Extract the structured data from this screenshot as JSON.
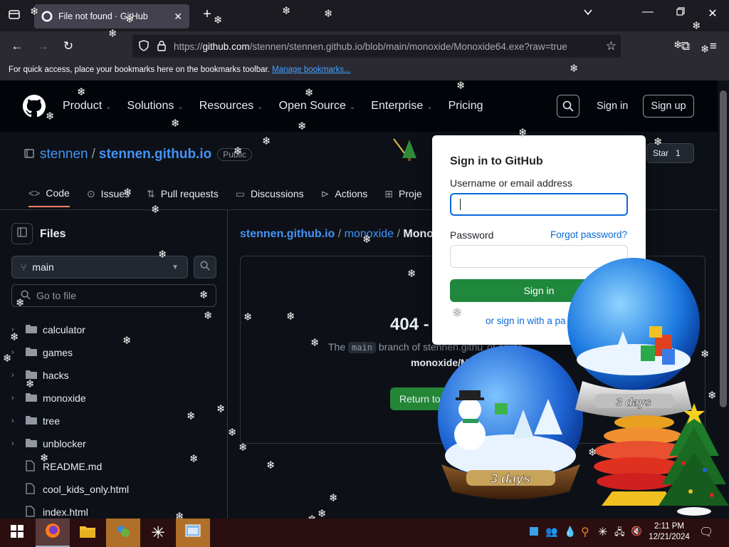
{
  "browser": {
    "tab_title": "File not found · GitHub",
    "url_prefix": "https://",
    "url_domain": "github.com",
    "url_path": "/stennen/stennen.github.io/blob/main/monoxide/Monoxide64.exe?raw=true",
    "bookmarks_text": "For quick access, place your bookmarks here on the bookmarks toolbar.",
    "bookmarks_link": "Manage bookmarks..."
  },
  "github": {
    "nav": [
      "Product",
      "Solutions",
      "Resources",
      "Open Source",
      "Enterprise",
      "Pricing"
    ],
    "sign_in": "Sign in",
    "sign_up": "Sign up",
    "owner": "stennen",
    "repo": "stennen.github.io",
    "visibility": "Public",
    "star_label": "Star",
    "star_count": "1",
    "tabs": [
      "Code",
      "Issues",
      "Pull requests",
      "Discussions",
      "Actions",
      "Proje"
    ],
    "files_title": "Files",
    "branch": "main",
    "go_to_file": "Go to file",
    "tree": [
      {
        "name": "calculator",
        "type": "folder"
      },
      {
        "name": "games",
        "type": "folder"
      },
      {
        "name": "hacks",
        "type": "folder"
      },
      {
        "name": "monoxide",
        "type": "folder"
      },
      {
        "name": "tree",
        "type": "folder"
      },
      {
        "name": "unblocker",
        "type": "folder"
      },
      {
        "name": "README.md",
        "type": "file"
      },
      {
        "name": "cool_kids_only.html",
        "type": "file"
      },
      {
        "name": "index.html",
        "type": "file"
      }
    ],
    "breadcrumb_root": "stennen.github.io",
    "breadcrumb_dir": "monoxide",
    "breadcrumb_file": "Mono",
    "error_title": "404 -",
    "error_the": "The",
    "error_branch": "main",
    "error_rest": "branch of stennen.githu",
    "error_rest2": "ot conta",
    "error_file": "monoxide/M",
    "return_btn": "Return to"
  },
  "signin_popover": {
    "title": "Sign in to GitHub",
    "username_label": "Username or email address",
    "password_label": "Password",
    "forgot": "Forgot password?",
    "submit": "Sign in",
    "alt": "or sign in with a pa"
  },
  "overlay": {
    "globe_label": "3 days"
  },
  "taskbar": {
    "time": "2:11 PM",
    "date": "12/21/2024"
  },
  "colors": {
    "link": "#4493f8",
    "green": "#238636",
    "taskbar": "#2a0e10"
  }
}
